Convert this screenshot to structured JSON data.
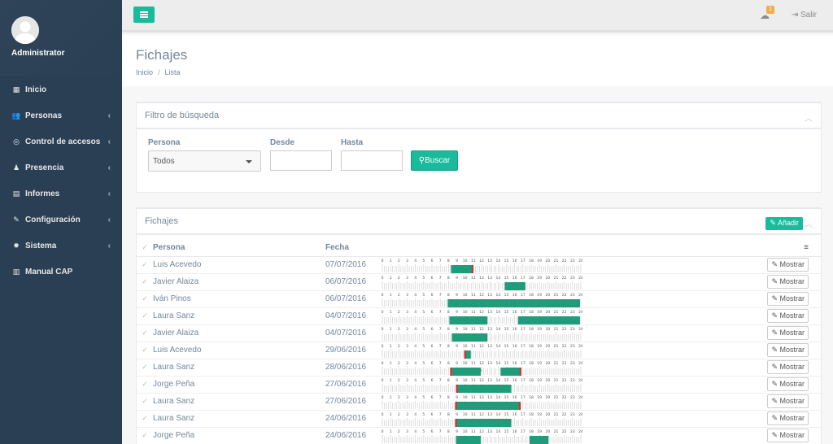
{
  "sidebar": {
    "user_name": "Administrator",
    "items": [
      {
        "label": "Inicio",
        "icon": "dashboard-icon",
        "chevron": false
      },
      {
        "label": "Personas",
        "icon": "users-icon",
        "chevron": true
      },
      {
        "label": "Control de accesos",
        "icon": "fingerprint-icon",
        "chevron": true
      },
      {
        "label": "Presencia",
        "icon": "user-icon",
        "chevron": true
      },
      {
        "label": "Informes",
        "icon": "file-icon",
        "chevron": true
      },
      {
        "label": "Configuración",
        "icon": "wrench-icon",
        "chevron": true
      },
      {
        "label": "Sistema",
        "icon": "gear-icon",
        "chevron": true
      },
      {
        "label": "Manual CAP",
        "icon": "book-icon",
        "chevron": false
      }
    ]
  },
  "topbar": {
    "notification_count": "1",
    "logout_label": "Salir"
  },
  "page": {
    "title": "Fichajes",
    "breadcrumb": [
      "Inicio",
      "Lista"
    ]
  },
  "filter": {
    "title": "Filtro de búsqueda",
    "persona_label": "Persona",
    "persona_value": "Todos",
    "desde_label": "Desde",
    "hasta_label": "Hasta",
    "search_button": "Buscar"
  },
  "list": {
    "title": "Fichajes",
    "add_button": "Añadir",
    "columns": [
      "Persona",
      "Fecha"
    ],
    "show_button": "Mostrar",
    "hour_labels": [
      "0",
      "1",
      "2",
      "3",
      "4",
      "5",
      "6",
      "7",
      "8",
      "9",
      "10",
      "11",
      "12",
      "13",
      "14",
      "15",
      "16",
      "17",
      "18",
      "19",
      "20",
      "21",
      "22",
      "23",
      "24"
    ],
    "colors": {
      "present": "#1f9d7a",
      "mark": "#d9302c",
      "pending": "#e28a80"
    },
    "rows": [
      {
        "persona": "Luis Acevedo",
        "fecha": "07/07/2016",
        "spans": [
          [
            8.3,
            10.9
          ]
        ],
        "marks": [
          10.9
        ],
        "pending": []
      },
      {
        "persona": "Javier Alaiza",
        "fecha": "06/07/2016",
        "spans": [
          [
            14.8,
            17.3
          ]
        ],
        "marks": [],
        "pending": []
      },
      {
        "persona": "Iván Pinos",
        "fecha": "06/07/2016",
        "spans": [
          [
            7.9,
            23.9
          ]
        ],
        "marks": [],
        "pending": []
      },
      {
        "persona": "Laura Sanz",
        "fecha": "04/07/2016",
        "spans": [
          [
            8.1,
            12.7
          ],
          [
            16.4,
            23.9
          ]
        ],
        "marks": [],
        "pending": []
      },
      {
        "persona": "Javier Alaiza",
        "fecha": "04/07/2016",
        "spans": [
          [
            8.4,
            12.7
          ]
        ],
        "marks": [],
        "pending": []
      },
      {
        "persona": "Luis Acevedo",
        "fecha": "29/06/2016",
        "spans": [
          [
            9.9,
            10.7
          ]
        ],
        "marks": [
          10.0
        ],
        "pending": []
      },
      {
        "persona": "Laura Sanz",
        "fecha": "28/06/2016",
        "spans": [
          [
            8.2,
            11.9
          ],
          [
            14.3,
            16.8
          ]
        ],
        "marks": [
          8.3,
          16.7
        ],
        "pending": [
          [
            10.3,
            12.0
          ]
        ]
      },
      {
        "persona": "Jorge Peña",
        "fecha": "27/06/2016",
        "spans": [
          [
            8.9,
            15.6
          ]
        ],
        "marks": [
          9.0
        ],
        "pending": []
      },
      {
        "persona": "Laura Sanz",
        "fecha": "27/06/2016",
        "spans": [
          [
            8.8,
            16.7
          ]
        ],
        "marks": [
          8.9,
          16.6
        ],
        "pending": []
      },
      {
        "persona": "Laura Sanz",
        "fecha": "24/06/2016",
        "spans": [
          [
            8.8,
            15.6
          ]
        ],
        "marks": [
          8.9
        ],
        "pending": []
      },
      {
        "persona": "Jorge Peña",
        "fecha": "24/06/2016",
        "spans": [
          [
            8.9,
            11.9
          ],
          [
            17.8,
            20.1
          ]
        ],
        "marks": [],
        "pending": []
      }
    ]
  }
}
